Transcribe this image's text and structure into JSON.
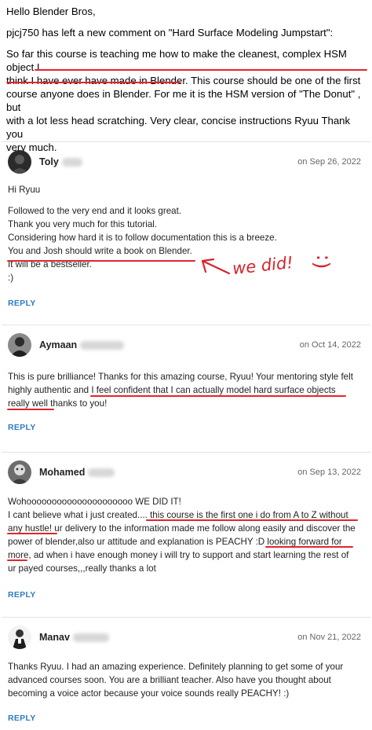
{
  "email": {
    "greeting": "Hello Blender Bros,",
    "notice": "pjcj750 has left a new comment on \"Hard Surface Modeling Jumpstart\":",
    "lines": [
      "So far this course is teaching me how to make the cleanest, complex HSM object I",
      "think I have ever have made in Blender. This course should be one of the first",
      "course anyone does in Blender. For me it is the HSM version of \"The Donut\" , but",
      "with a lot less head scratching. Very clear, concise instructions Ryuu Thank you",
      "very much."
    ]
  },
  "comments": [
    {
      "author": "Toly",
      "date": "on Sep 26, 2022",
      "lines": [
        "Hi Ryuu",
        "",
        "Followed to the very end and it looks great.",
        "Thank you very much for this tutorial.",
        "Considering how hard it is to follow documentation this is a breeze.",
        "You and Josh should write a book on Blender.",
        "It will be a bestseller.",
        ":)"
      ],
      "reply": "REPLY"
    },
    {
      "author": "Aymaan",
      "date": "on Oct 14, 2022",
      "lines": [
        "This is pure brilliance! Thanks for this amazing course, Ryuu! Your mentoring style felt",
        "highly authentic and I feel confident that I can actually model hard surface objects",
        "really well thanks to you!"
      ],
      "reply": "REPLY"
    },
    {
      "author": "Mohamed",
      "date": "on Sep 13, 2022",
      "lines": [
        "Wohooooooooooooooooooooo WE DID IT!",
        "I cant believe what i just created.... this course is the first one i do from A to Z without",
        "any hustle! ur delivery to the information made me follow along easily and discover the",
        "power of blender,also ur attitude and explanation is PEACHY :D looking forward for",
        "more, ad when i have enough money i will try to support and start learning the rest of",
        "ur payed courses,,,really thanks a lot"
      ],
      "reply": "REPLY"
    },
    {
      "author": "Manav",
      "date": "on Nov 21, 2022",
      "lines": [
        "Thanks Ryuu. I had an amazing experience. Definitely planning to get some of your",
        "advanced courses soon. You are a brilliant teacher. Also have you thought about",
        "becoming a voice actor because your voice sounds really PEACHY! :)"
      ],
      "reply": "REPLY"
    }
  ],
  "annotation": {
    "text": "we did!",
    "smiley": "(: ",
    "color": "#d6252b"
  },
  "colors": {
    "reply": "#2f7bc4",
    "underline": "#e0262c",
    "divider": "#e3e3e3"
  }
}
